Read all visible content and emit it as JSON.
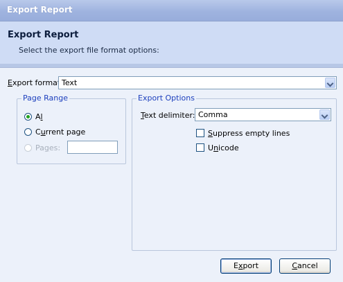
{
  "window": {
    "title": "Export Report"
  },
  "header": {
    "title": "Export Report",
    "subtitle": "Select the export file format options:"
  },
  "export_format": {
    "label_prefix": "",
    "label_mnemonic": "E",
    "label_rest": "xport format:",
    "value": "Text"
  },
  "page_range": {
    "legend": "Page Range",
    "all": {
      "mnemonic_pre": "A",
      "mnemonic": "l",
      "rest": "l",
      "checked": true
    },
    "current": {
      "pre": "C",
      "mnemonic": "u",
      "rest": "rrent page",
      "checked": false
    },
    "pages": {
      "pre": "Pa",
      "mnemonic": "g",
      "rest": "es:",
      "value": "",
      "enabled": false
    }
  },
  "export_options": {
    "legend": "Export Options",
    "delimiter": {
      "mnemonic": "T",
      "rest": "ext delimiter:",
      "value": "Comma"
    },
    "suppress_empty_lines": {
      "mnemonic": "S",
      "rest": "uppress empty lines",
      "checked": false
    },
    "unicode": {
      "pre": "U",
      "mnemonic": "n",
      "rest": "icode",
      "checked": false
    }
  },
  "buttons": {
    "export": {
      "pre": "E",
      "mnemonic": "x",
      "rest": "port"
    },
    "cancel": {
      "mnemonic": "C",
      "rest": "ancel"
    }
  },
  "colors": {
    "accent": "#1c3fbd",
    "title_bar": "#9fb3df",
    "header_bg": "#cfdcf5",
    "radio_dot": "#21a121"
  }
}
